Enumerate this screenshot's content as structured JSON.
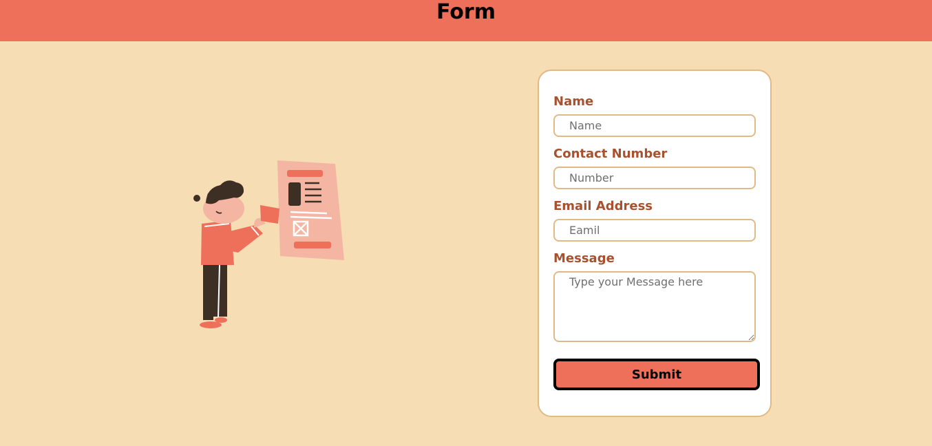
{
  "header": {
    "title": "Form"
  },
  "form": {
    "fields": [
      {
        "label": "Name",
        "placeholder": "Name"
      },
      {
        "label": "Contact Number",
        "placeholder": "Number"
      },
      {
        "label": "Email Address",
        "placeholder": "Eamil"
      },
      {
        "label": "Message",
        "placeholder": "Type your Message here"
      }
    ],
    "submit_label": "Submit"
  },
  "colors": {
    "background": "#f6ddb3",
    "header": "#ee705b",
    "label": "#a8512f",
    "border": "#e0b986",
    "button": "#ee705b"
  },
  "icons": [
    "person-with-document-illustration"
  ]
}
